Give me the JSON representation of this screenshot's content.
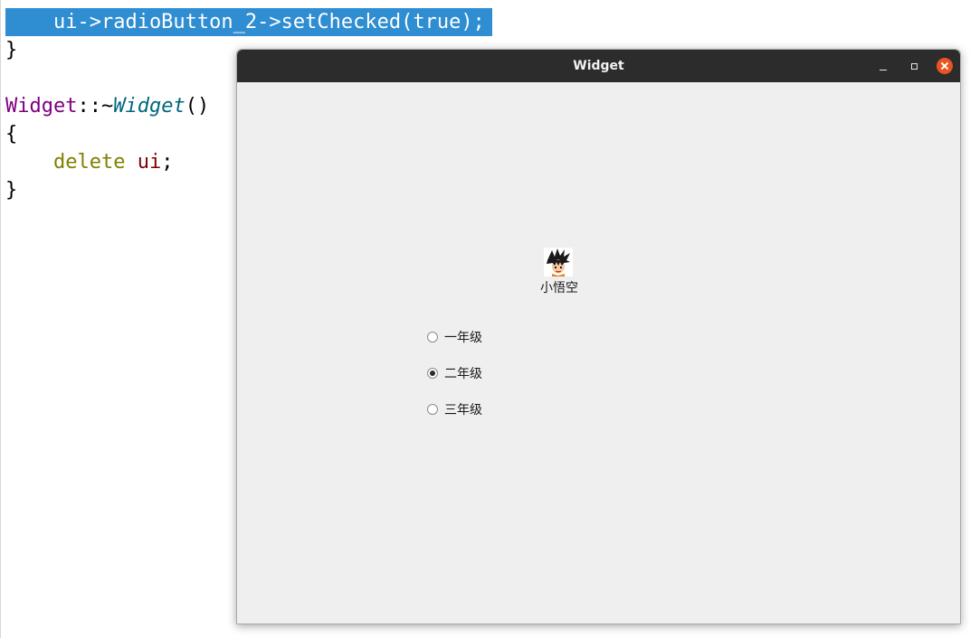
{
  "editor": {
    "lines": [
      {
        "text": "    ui->radioButton_2->setChecked(true);"
      },
      {
        "text": "}"
      },
      {
        "text": ""
      },
      {
        "class_name": "Widget",
        "separator": "::~",
        "func_name": "Widget",
        "parens": "()"
      },
      {
        "text": "{"
      },
      {
        "indent": "    ",
        "keyword": "delete",
        "space": " ",
        "var": "ui",
        "semi": ";"
      },
      {
        "text": "}"
      }
    ]
  },
  "window": {
    "title": "Widget",
    "controls": {
      "minimize_icon": "minimize-icon",
      "maximize_icon": "maximize-icon",
      "close_icon": "close-icon",
      "close_color": "#e95420"
    },
    "avatar": {
      "icon": "goku-avatar-icon",
      "label": "小悟空"
    },
    "radios": [
      {
        "label": "一年级",
        "checked": false
      },
      {
        "label": "二年级",
        "checked": true
      },
      {
        "label": "三年级",
        "checked": false
      }
    ]
  },
  "colors": {
    "selection": "#2f8dd1",
    "titlebar": "#2c2c2c",
    "window_bg": "#efefef"
  }
}
